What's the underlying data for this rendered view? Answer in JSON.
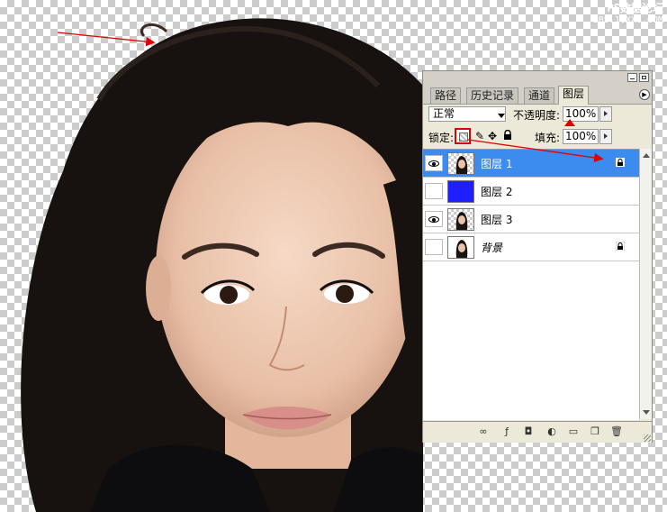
{
  "watermark": {
    "line1": "PS数据论坛",
    "line2": "BBS.16XX8.COM"
  },
  "panel": {
    "tabs": [
      "路径",
      "历史记录",
      "通道",
      "图层"
    ],
    "active_tab": "图层",
    "blend_mode": "正常",
    "opacity_label": "不透明度:",
    "opacity_value": "100%",
    "lock_label": "锁定:",
    "fill_label": "填充:",
    "fill_value": "100%",
    "layers": [
      {
        "name": "图层 1",
        "visible": true,
        "selected": true,
        "locked": true,
        "thumbnail": "portrait-transparent"
      },
      {
        "name": "图层 2",
        "visible": false,
        "selected": false,
        "locked": false,
        "thumbnail": "solid-blue"
      },
      {
        "name": "图层 3",
        "visible": true,
        "selected": false,
        "locked": false,
        "thumbnail": "portrait-transparent"
      },
      {
        "name": "背景",
        "visible": false,
        "selected": false,
        "locked": true,
        "thumbnail": "portrait-white"
      }
    ],
    "bottom_icons": [
      "link-icon",
      "fx-icon",
      "mask-icon",
      "adjustment-icon",
      "group-folder-icon",
      "new-layer-icon",
      "trash-icon"
    ]
  },
  "colors": {
    "selection": "#3c8cf0",
    "layer2_fill": "#1e1eff",
    "annotation": "#e00000"
  }
}
